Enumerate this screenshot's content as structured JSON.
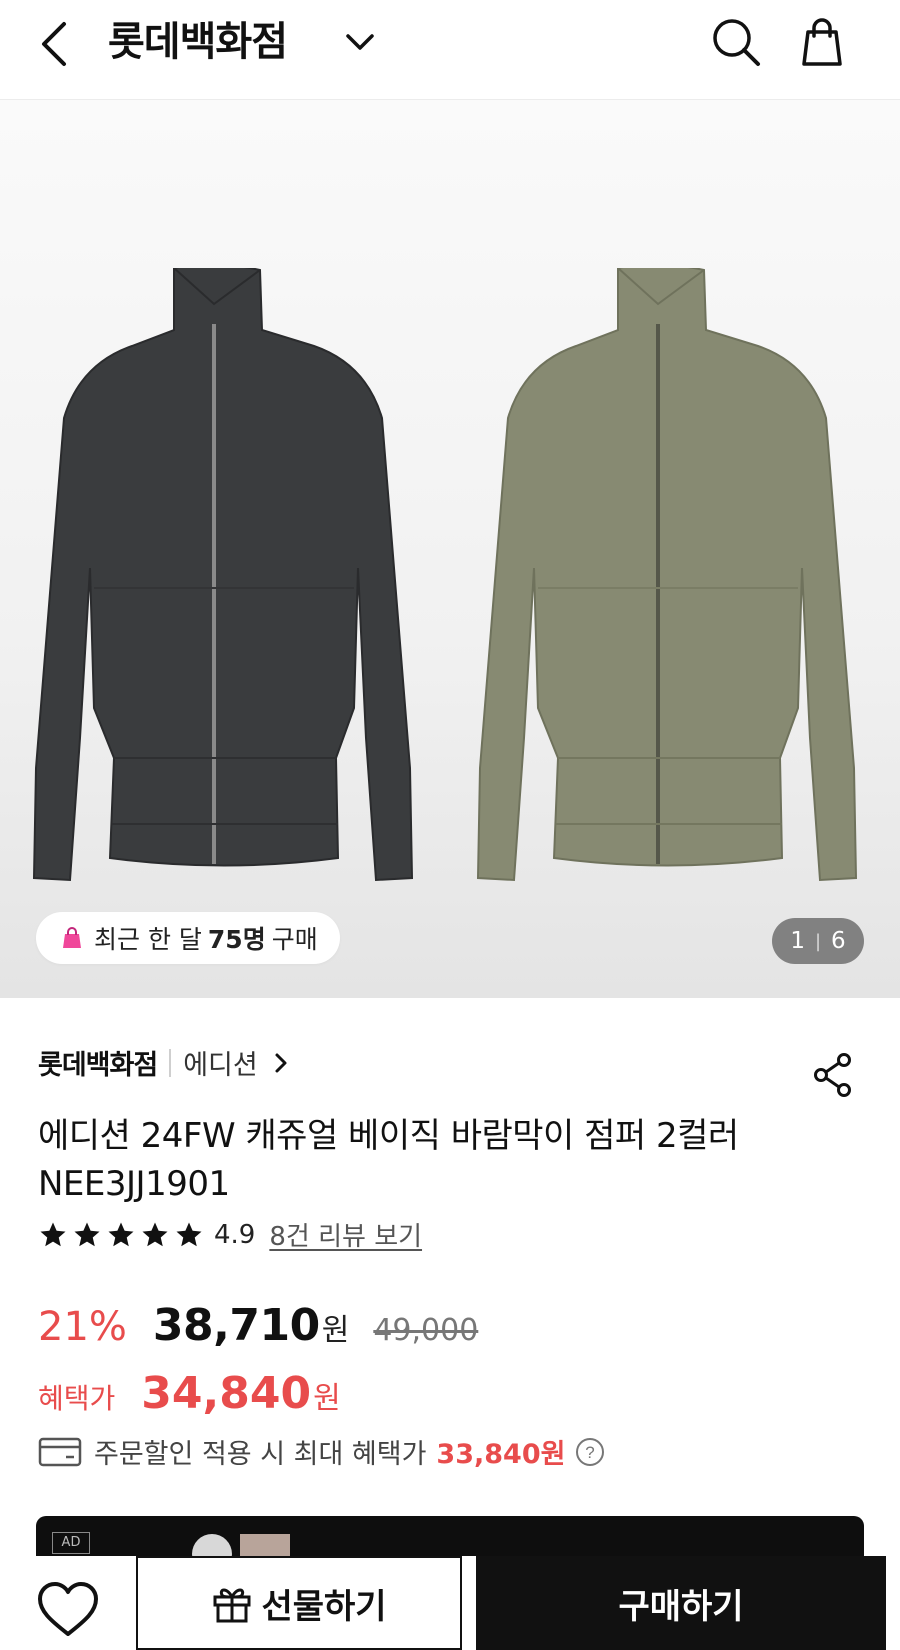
{
  "header": {
    "title": "롯데백화점",
    "icons": [
      "back-arrow-icon",
      "chevron-down-icon",
      "search-icon",
      "shopping-bag-icon"
    ]
  },
  "gallery": {
    "recent_prefix": "최근 한 달",
    "recent_count": "75명",
    "recent_suffix": "구매",
    "page_current": "1",
    "page_total": "6",
    "colors": [
      "dark charcoal",
      "khaki"
    ]
  },
  "product": {
    "brand_main": "롯데백화점",
    "brand_sub": "에디션",
    "title_line1": "에디션 24FW 캐쥬얼 베이직 바람막이 점퍼 2컬러",
    "title_line2": "NEE3JJ1901",
    "rating": "4.9",
    "stars": 5,
    "review_link": "8건 리뷰 보기"
  },
  "price": {
    "discount": "21%",
    "sale_price": "38,710",
    "won": "원",
    "original_price": "49,000",
    "benefit_label": "혜택가",
    "benefit_price": "34,840",
    "coupon_text": "주문할인 적용 시 최대 혜택가",
    "coupon_amount": "33,840원"
  },
  "ad": {
    "tag": "AD"
  },
  "bottom": {
    "gift_label": "선물하기",
    "buy_label": "구매하기"
  },
  "colors": {
    "accent_red": "#e84c4c",
    "primary_black": "#111111"
  }
}
